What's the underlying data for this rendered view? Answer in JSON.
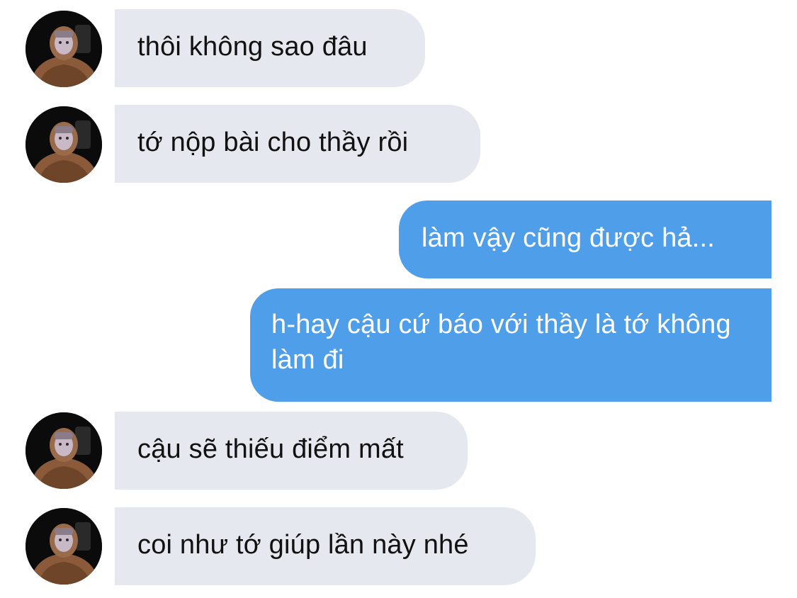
{
  "conversation": {
    "messages": [
      {
        "sender": "them",
        "text": "thôi không sao đâu"
      },
      {
        "sender": "them",
        "text": "tớ nộp bài cho thầy rồi"
      },
      {
        "sender": "me",
        "text": "làm vậy cũng được hả..."
      },
      {
        "sender": "me",
        "text": "h-hay cậu cứ báo với thầy là tớ không làm đi"
      },
      {
        "sender": "them",
        "text": "cậu sẽ thiếu điểm mất"
      },
      {
        "sender": "them",
        "text": "coi như tớ giúp lần này nhé"
      }
    ]
  },
  "colors": {
    "incoming_bubble": "#e5e8ee",
    "outgoing_bubble": "#4e9ee9",
    "incoming_text": "#111111",
    "outgoing_text": "#ffffff"
  },
  "icons": {
    "contact_avatar": "profile-photo-person-in-brown-hoodie"
  }
}
